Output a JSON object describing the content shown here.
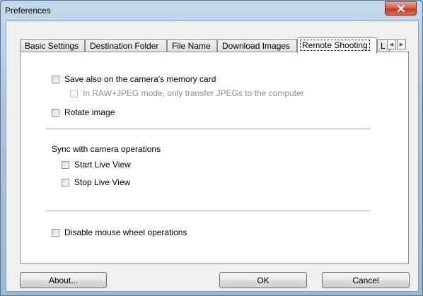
{
  "window": {
    "title": "Preferences"
  },
  "tabs": [
    {
      "label": "Basic Settings"
    },
    {
      "label": "Destination Folder"
    },
    {
      "label": "File Name"
    },
    {
      "label": "Download Images"
    },
    {
      "label": "Remote Shooting",
      "active": true
    },
    {
      "label": "L"
    }
  ],
  "options": {
    "save_memory_card": {
      "label": "Save also on the camera's memory card",
      "checked": false
    },
    "raw_jpeg": {
      "label": "In RAW+JPEG mode, only transfer JPEGs to the computer",
      "checked": false,
      "disabled": true
    },
    "rotate_image": {
      "label": "Rotate image",
      "checked": false
    },
    "sync_heading": "Sync with camera operations",
    "start_live_view": {
      "label": "Start Live View",
      "checked": false
    },
    "stop_live_view": {
      "label": "Stop Live View",
      "checked": false
    },
    "disable_mouse_wheel": {
      "label": "Disable mouse wheel operations",
      "checked": false
    }
  },
  "buttons": {
    "about": "About...",
    "ok": "OK",
    "cancel": "Cancel"
  }
}
